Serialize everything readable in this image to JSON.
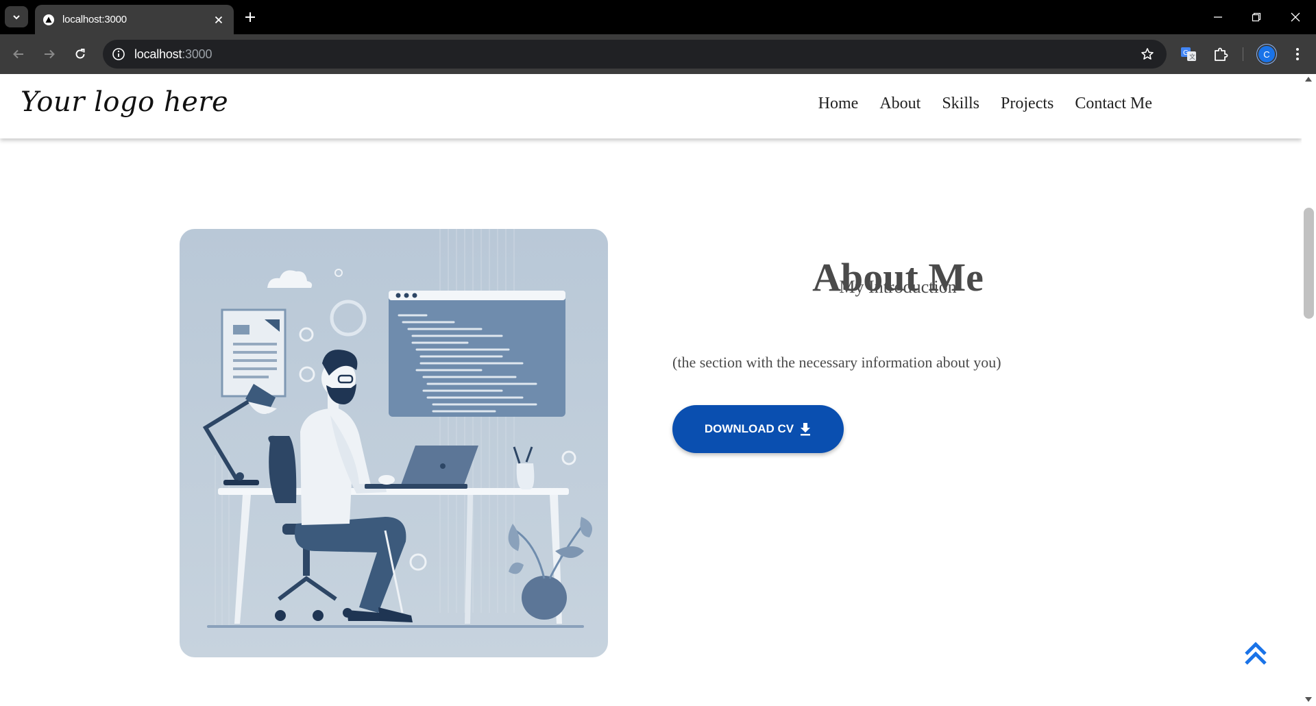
{
  "browser": {
    "tab_title": "localhost:3000",
    "url_host": "localhost",
    "url_port": ":3000",
    "profile_initial": "C",
    "icons": {
      "tab_menu": "chevron-down-icon",
      "favicon": "triangle-icon",
      "tab_close": "close-icon",
      "new_tab": "plus-icon",
      "back": "arrow-left-icon",
      "forward": "arrow-right-icon",
      "reload": "reload-icon",
      "site_info": "info-icon",
      "bookmark": "star-icon",
      "translate": "translate-icon",
      "extensions": "puzzle-icon",
      "menu": "kebab-menu-icon"
    }
  },
  "header": {
    "logo": "Your logo here",
    "nav": [
      {
        "label": "Home"
      },
      {
        "label": "About"
      },
      {
        "label": "Skills"
      },
      {
        "label": "Projects"
      },
      {
        "label": "Contact Me"
      }
    ]
  },
  "about": {
    "title": "About Me",
    "subtitle": "My Introduction",
    "description": "(the section with the necessary information about you)",
    "cv_button": "DOWNLOAD CV"
  },
  "colors": {
    "accent": "#0a4fb0",
    "scroll_top": "#1a73e8",
    "text": "#4a4a4a",
    "illustration_bg": "#bfccd9"
  }
}
